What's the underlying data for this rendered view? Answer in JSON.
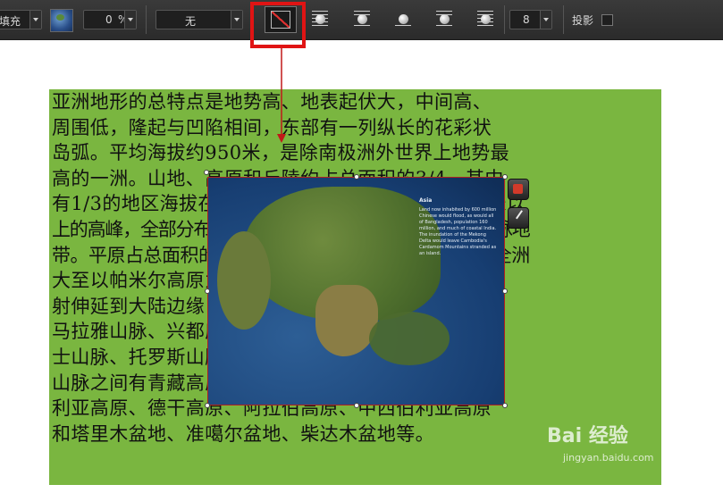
{
  "toolbar": {
    "fill_label": "填充",
    "opacity_value": "0",
    "opacity_unit": "%",
    "style_value": "无",
    "spacing_value": "8",
    "shadow_label": "投影"
  },
  "document": {
    "lines": [
      "亚洲地形的总特点是地势高、地表起伏大，中间高、",
      "周围低，隆起与凹陷相间，东部有一列纵长的花彩状",
      "岛弧。平均海拔约950米，是除南极洲外世界上地势最",
      "高的一洲。山地、高原和丘陵约占总面积的3/4，其中",
      "有1/3的地区海拔在2000米以上。世界上海拔8000米以",
      "上的高峰，全部分布在亚洲的喀喇昆仑山脉和喜马拉雅山脉地",
      "带。平原占总面积的1/4，面积约为1000万平方千米。全洲",
      "大至以帕米尔高原为中心，许多高大的山脉向四方辐",
      "射伸延到大陆边缘，主要有天山山脉、昆仑山脉、喜",
      "马拉雅山脉、兴都库什山脉、萨彦岭山脉、厄尔布尔",
      "士山脉、托罗斯山脉、扎格罗斯山脉等。在以上主干",
      "山脉之间有青藏高原、蒙古高原、伊朗高原、安纳托",
      "利亚高原、德干高原、阿拉伯高原、中西伯利亚高原",
      "和塔里木盆地、准噶尔盆地、柴达木盆地等。"
    ]
  },
  "image": {
    "panel_title": "Asia",
    "panel_text": "Land now inhabited by 600 million Chinese would flood, as would all of Bangladesh, population 160 million, and much of coastal India. The inundation of the Mekong Delta would leave Cambodia's Cardamom Mountains stranded as an island."
  },
  "watermark": {
    "brand": "Bai 经验",
    "url": "jingyan.baidu.com"
  },
  "colors": {
    "doc_background": "#7ab640",
    "highlight": "#e01414"
  }
}
